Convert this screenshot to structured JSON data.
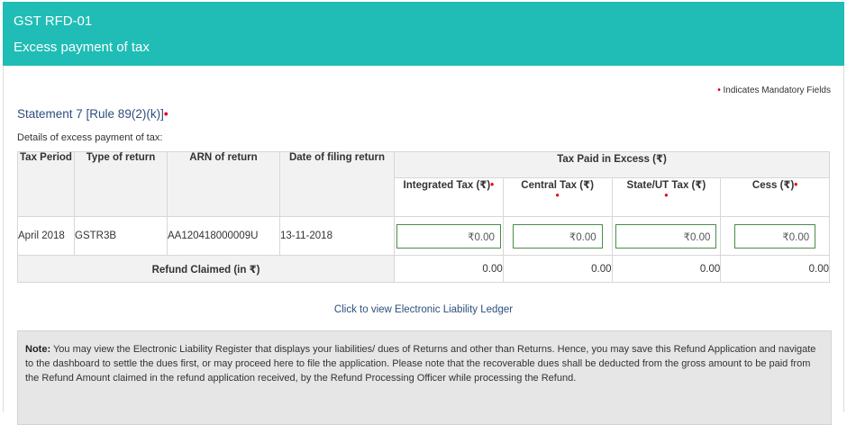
{
  "header": {
    "form_id": "GST RFD-01",
    "form_title": "Excess payment of tax"
  },
  "mandatory_note": "Indicates Mandatory Fields",
  "statement_title": "Statement 7 [Rule 89(2)(k)]",
  "details_label": "Details of excess payment of tax:",
  "table": {
    "headers": {
      "tax_period": "Tax Period",
      "type_of_return": "Type of return",
      "arn": "ARN of return",
      "date_of_filing": "Date of filing return",
      "tax_paid_group": "Tax Paid in Excess (₹)",
      "integrated": "Integrated Tax (₹)",
      "central": "Central Tax (₹)",
      "state": "State/UT Tax (₹)",
      "cess": "Cess (₹)"
    },
    "row": {
      "tax_period": "April 2018",
      "type_of_return": "GSTR3B",
      "arn": "AA120418000009U",
      "date_of_filing": "13-11-2018",
      "integrated": "₹0.00",
      "central": "₹0.00",
      "state": "₹0.00",
      "cess": "₹0.00"
    },
    "total": {
      "label": "Refund Claimed (in ₹)",
      "integrated": "0.00",
      "central": "0.00",
      "state": "0.00",
      "cess": "0.00"
    }
  },
  "ledger_link": "Click to view Electronic Liability Ledger",
  "note": {
    "label": "Note:",
    "text": "You may view the Electronic Liability Register that displays your liabilities/ dues of Returns and other than Returns. Hence, you may save this Refund Application and navigate to the dashboard to settle the dues first, or may proceed here to file the application. Please note that the recoverable dues shall be deducted from the gross amount to be paid from the Refund Amount claimed in the refund application received, by the Refund Processing Officer while processing the Refund."
  },
  "colors": {
    "header_bg": "#1fbdb5",
    "mandatory_dot": "#e3001b",
    "link": "#2e4e7d",
    "input_border": "#4a8b4a"
  }
}
